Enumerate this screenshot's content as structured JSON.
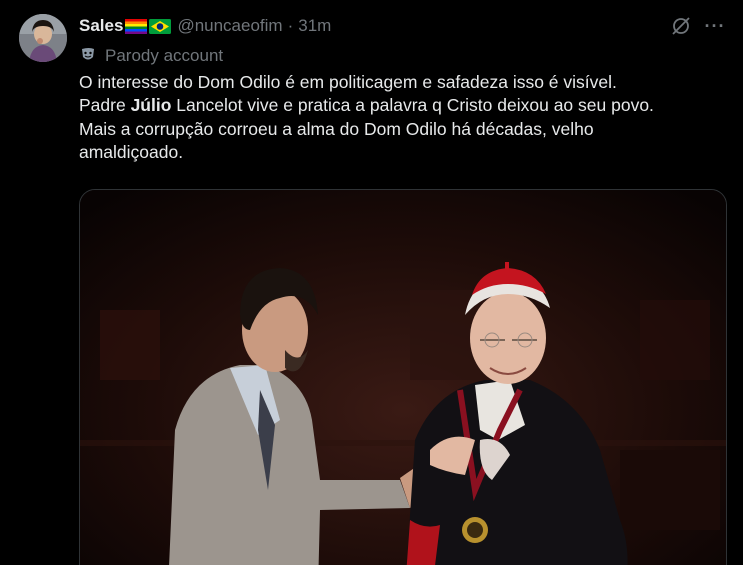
{
  "author": {
    "name": "Sales",
    "handle": "@nuncaeofim",
    "separator": "·",
    "time": "31m",
    "badges": [
      "rainbow-flag-icon",
      "brazil-flag-icon"
    ],
    "label": "Parody account"
  },
  "post": {
    "lines": [
      {
        "text": "O interesse do Dom Odilo é em politicagem e safadeza isso é visível."
      },
      {
        "before": "Padre ",
        "bold": "Júlio",
        "after": " Lancelot vive e pratica a palavra q Cristo deixou ao seu povo."
      },
      {
        "text": "Mais a corrupção corroeu a alma do Dom Odilo há décadas, velho"
      },
      {
        "text": "amaldiçoado."
      }
    ]
  },
  "actions": {
    "grok_icon": "grok-icon",
    "more_label": "···"
  },
  "colors": {
    "background": "#000000",
    "text_primary": "#e7e9ea",
    "text_secondary": "#71767b",
    "border": "#2f3336"
  }
}
